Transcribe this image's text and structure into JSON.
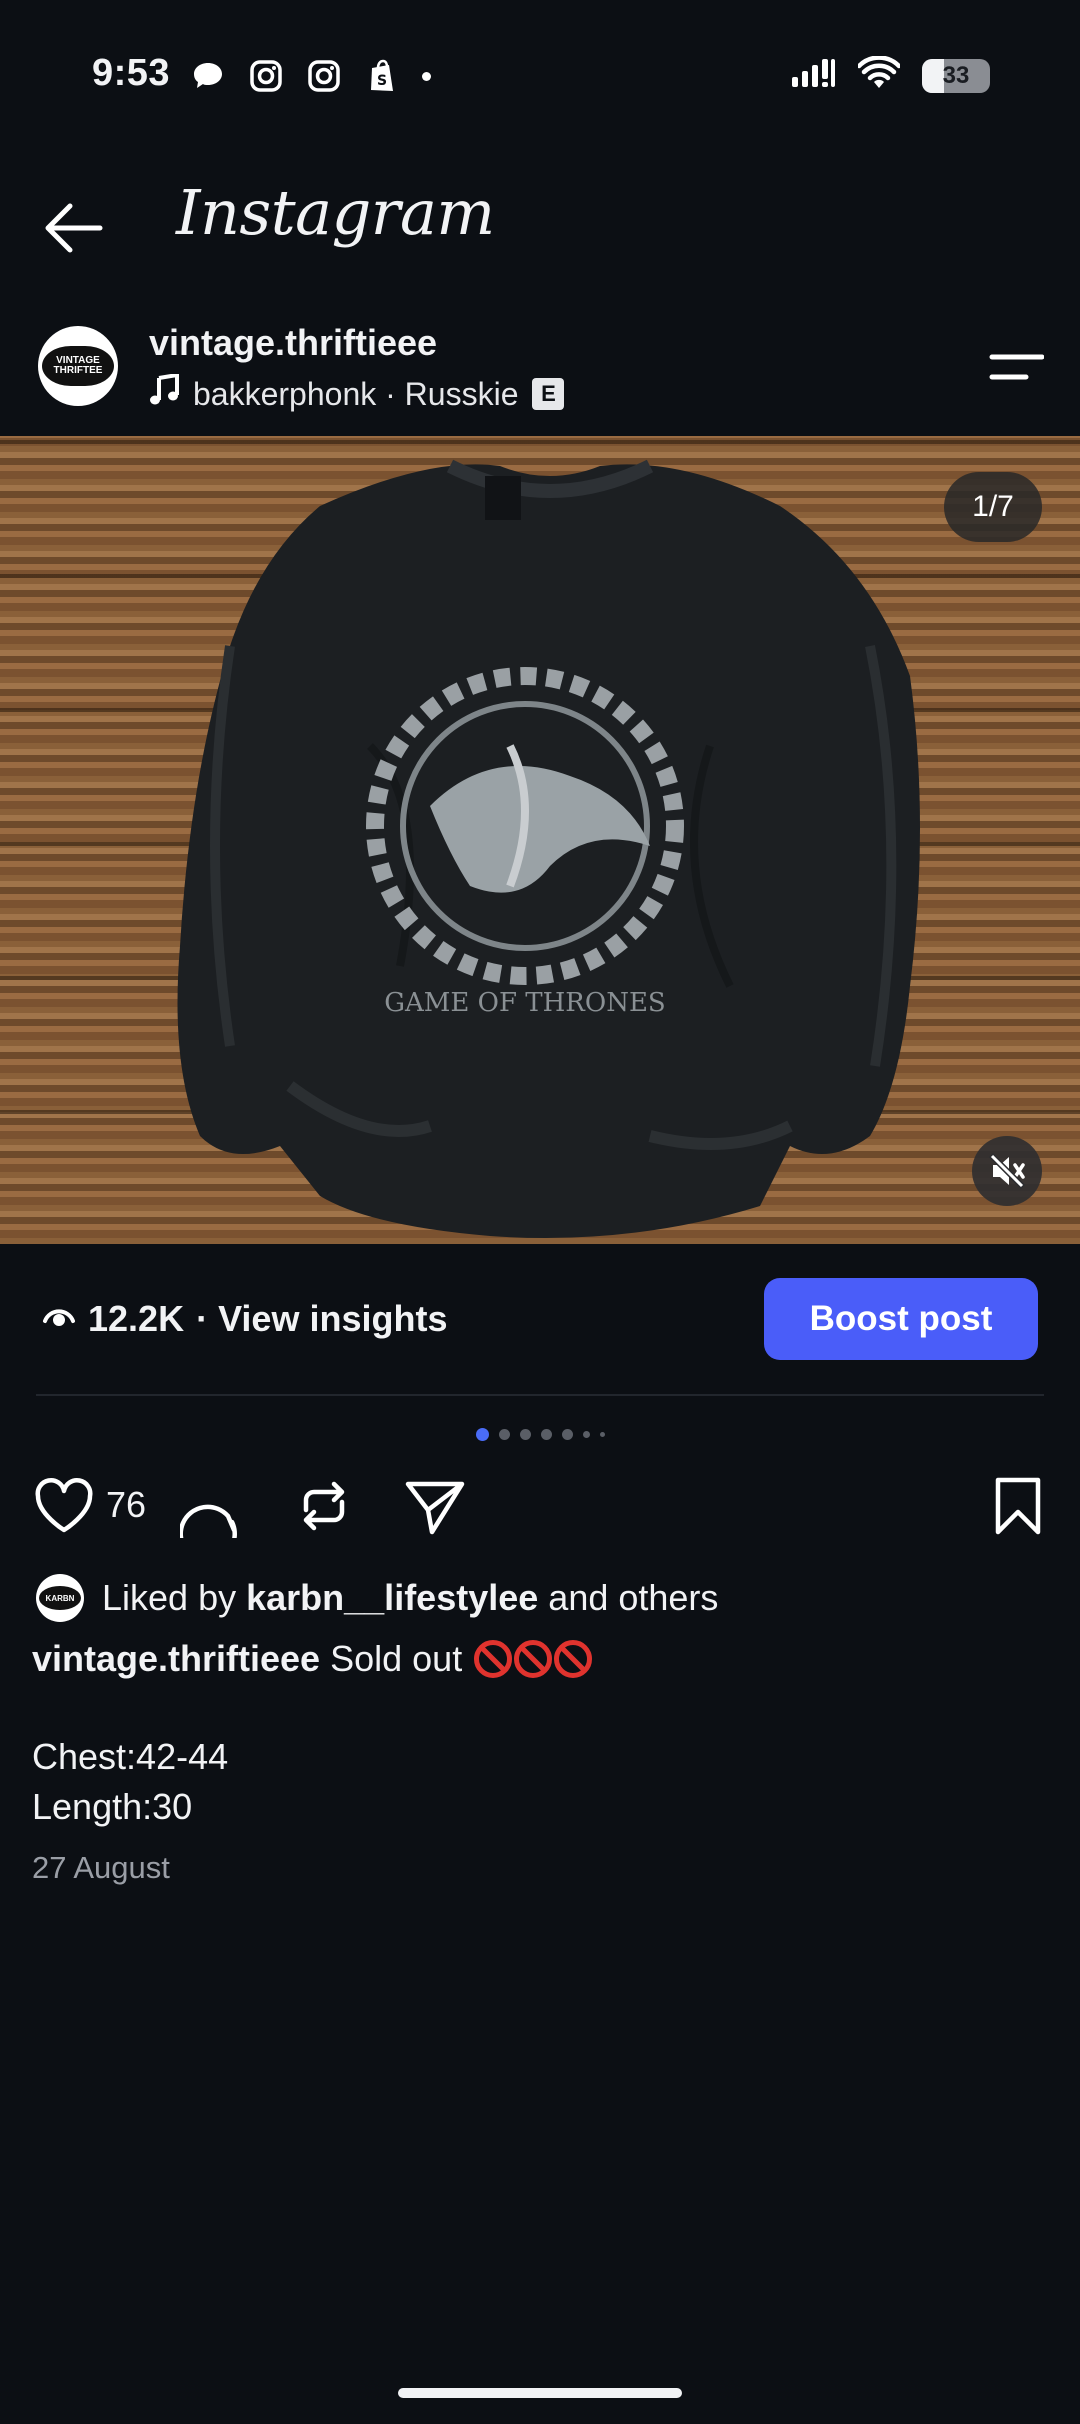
{
  "status": {
    "time": "9:53",
    "battery": "33"
  },
  "header": {
    "app_title": "Instagram"
  },
  "post": {
    "username": "vintage.thriftieee",
    "audio": "bakkerphonk · Russkie",
    "explicit_badge": "E",
    "avatar_text": "VINTAGE THRIFTEE",
    "image_counter": "1/7",
    "views": "12.2K",
    "insights_label": "· View insights",
    "boost_label": "Boost post",
    "like_count": "76",
    "liked_by_prefix": "Liked by",
    "liked_by_user": "karbn__lifestylee",
    "liked_by_suffix": "and others",
    "liked_avatar_text": "KARBN",
    "caption_user": "vintage.thriftieee",
    "caption_text": "Sold out",
    "caption_line_1": "Chest:42-44",
    "caption_line_2": "Length:30",
    "date": "27 August"
  },
  "colors": {
    "accent": "#4a5df9",
    "background": "#0c0f14"
  }
}
